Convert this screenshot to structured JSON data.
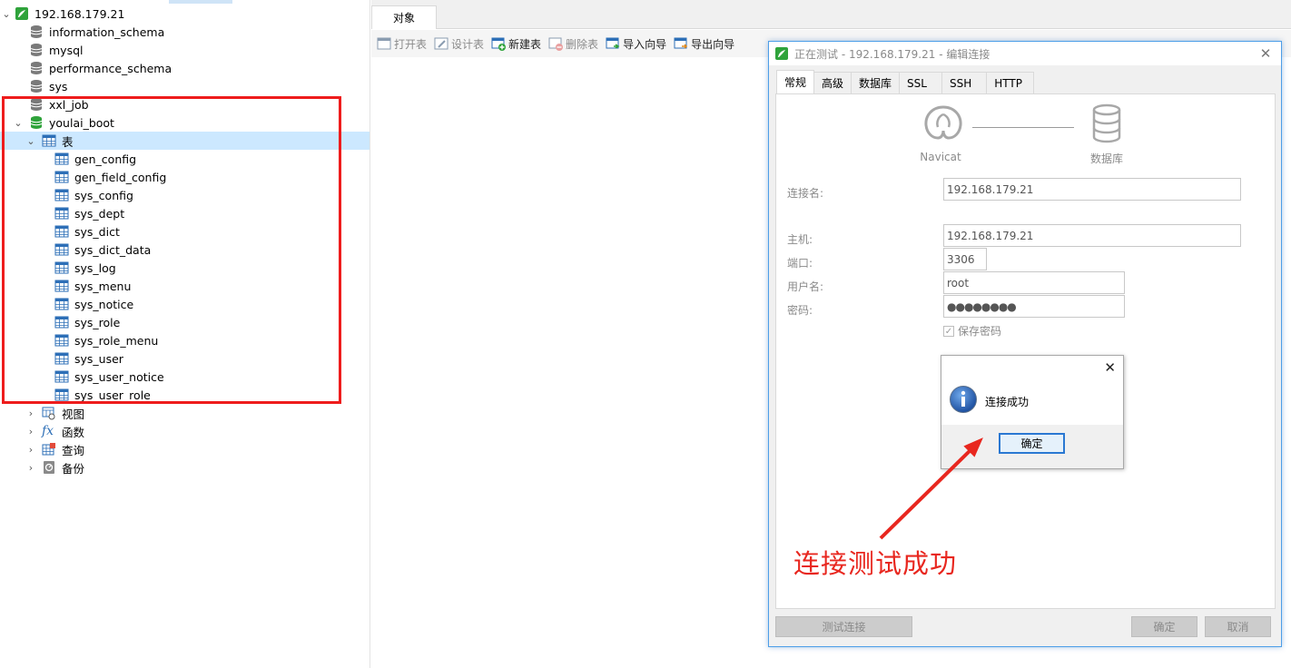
{
  "tree": {
    "connection": "192.168.179.21",
    "databases": [
      "information_schema",
      "mysql",
      "performance_schema",
      "sys",
      "xxl_job"
    ],
    "active_db": "youlai_boot",
    "tables_group": "表",
    "tables": [
      "gen_config",
      "gen_field_config",
      "sys_config",
      "sys_dept",
      "sys_dict",
      "sys_dict_data",
      "sys_log",
      "sys_menu",
      "sys_notice",
      "sys_role",
      "sys_role_menu",
      "sys_user",
      "sys_user_notice",
      "sys_user_role"
    ],
    "other_groups": [
      "视图",
      "函数",
      "查询",
      "备份"
    ]
  },
  "main": {
    "tab": "对象",
    "toolbar": [
      "打开表",
      "设计表",
      "新建表",
      "删除表",
      "导入向导",
      "导出向导"
    ]
  },
  "dialog": {
    "title": "正在测试 - 192.168.179.21 - 编辑连接",
    "tabs": [
      "常规",
      "高级",
      "数据库",
      "SSL",
      "SSH",
      "HTTP"
    ],
    "navicat_caption": "Navicat",
    "db_caption": "数据库",
    "fields": {
      "conn_name_label": "连接名:",
      "conn_name": "192.168.179.21",
      "host_label": "主机:",
      "host": "192.168.179.21",
      "port_label": "端口:",
      "port": "3306",
      "user_label": "用户名:",
      "user": "root",
      "pass_label": "密码:",
      "pass": "●●●●●●●●",
      "save_pass": "保存密码"
    },
    "buttons": {
      "test": "测试连接",
      "ok": "确定",
      "cancel": "取消"
    }
  },
  "message": {
    "text": "连接成功",
    "ok": "确定"
  },
  "annotation": "连接测试成功",
  "colors": {
    "highlight": "#cce8ff",
    "red": "#ee1c1c",
    "db_green": "#2fa33b",
    "table_blue": "#2d6fb7"
  }
}
